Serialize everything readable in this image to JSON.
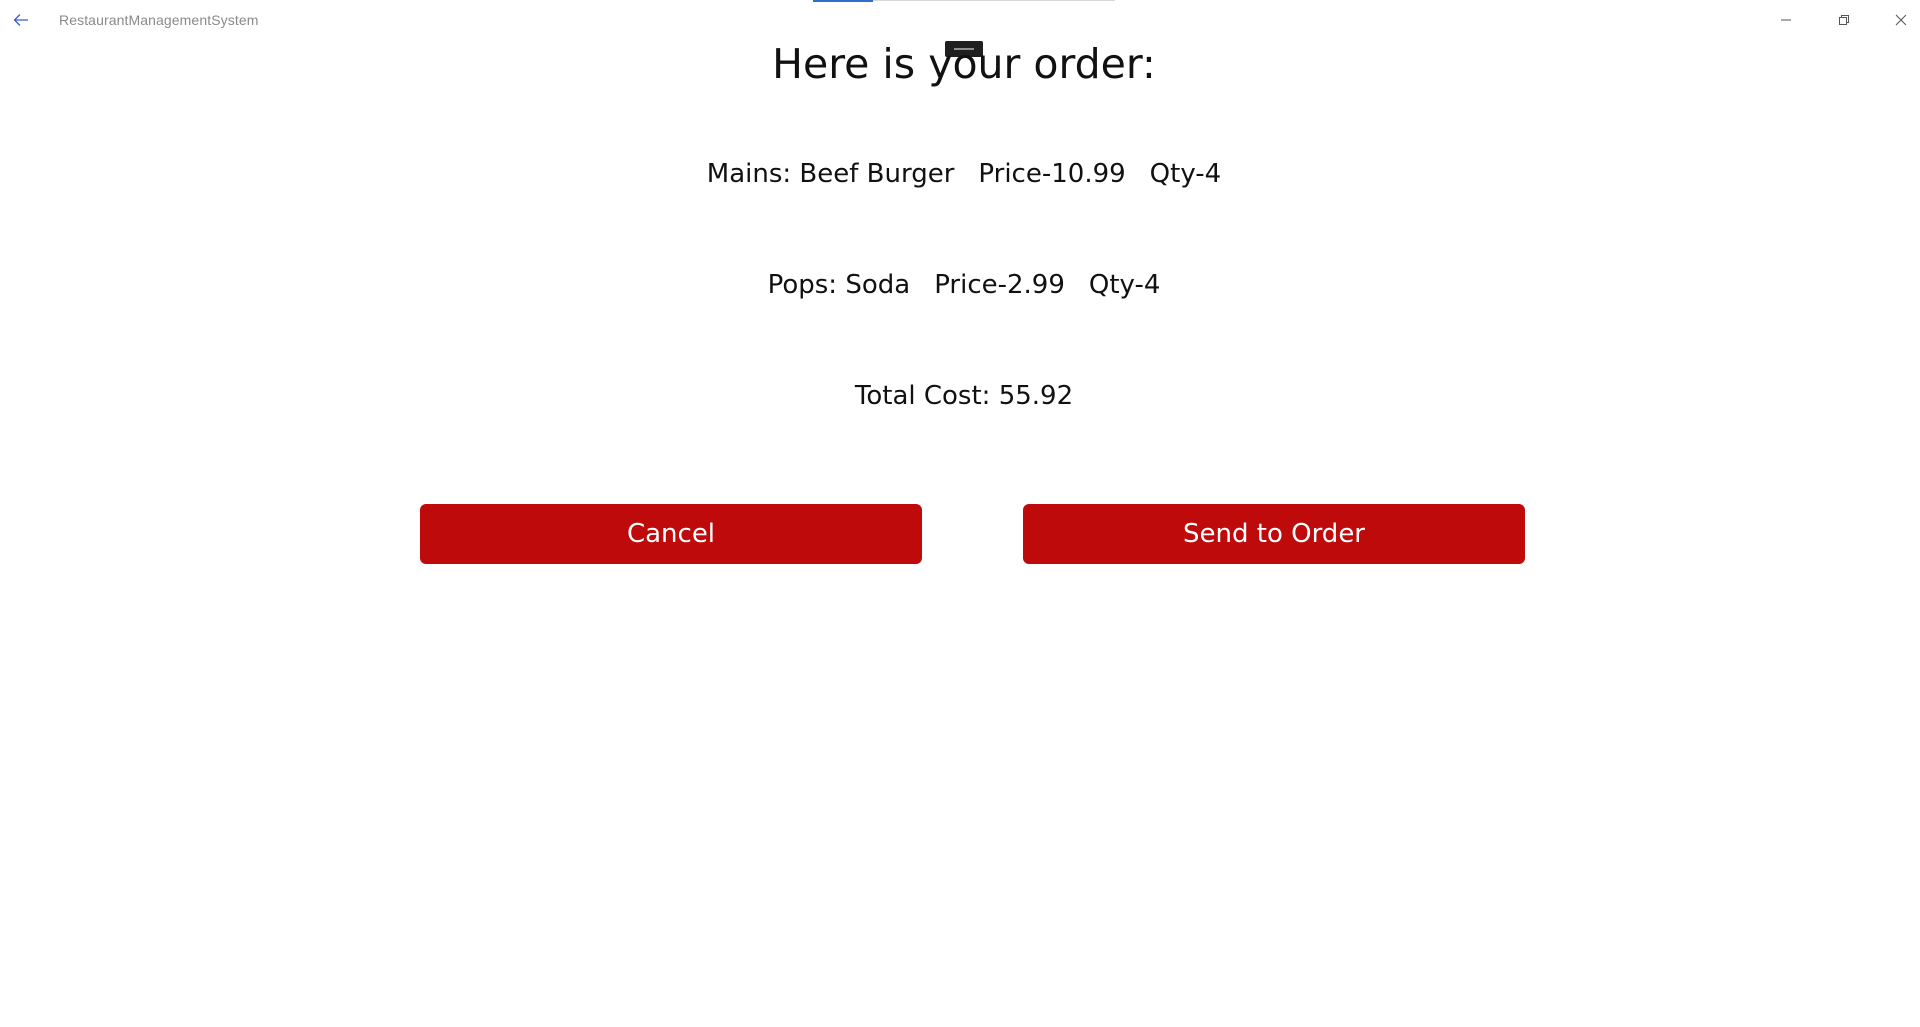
{
  "app": {
    "title": "RestaurantManagementSystem",
    "accent_color": "#2f6fc7",
    "button_color": "#be0a0a"
  },
  "titlebar": {
    "back_icon": "back-arrow-icon",
    "minimize_icon": "minimize-icon",
    "maximize_icon": "restore-icon",
    "close_icon": "close-icon"
  },
  "order": {
    "heading": "Here is your order:",
    "mains": {
      "label": "Mains: Beef Burger",
      "price": "Price-10.99",
      "qty": "Qty-4"
    },
    "pops": {
      "label": "Pops: Soda",
      "price": "Price-2.99",
      "qty": "Qty-4"
    },
    "total": "Total Cost: 55.92"
  },
  "actions": {
    "cancel_label": "Cancel",
    "send_label": "Send to Order"
  },
  "progress": {
    "fraction": 0.2
  }
}
